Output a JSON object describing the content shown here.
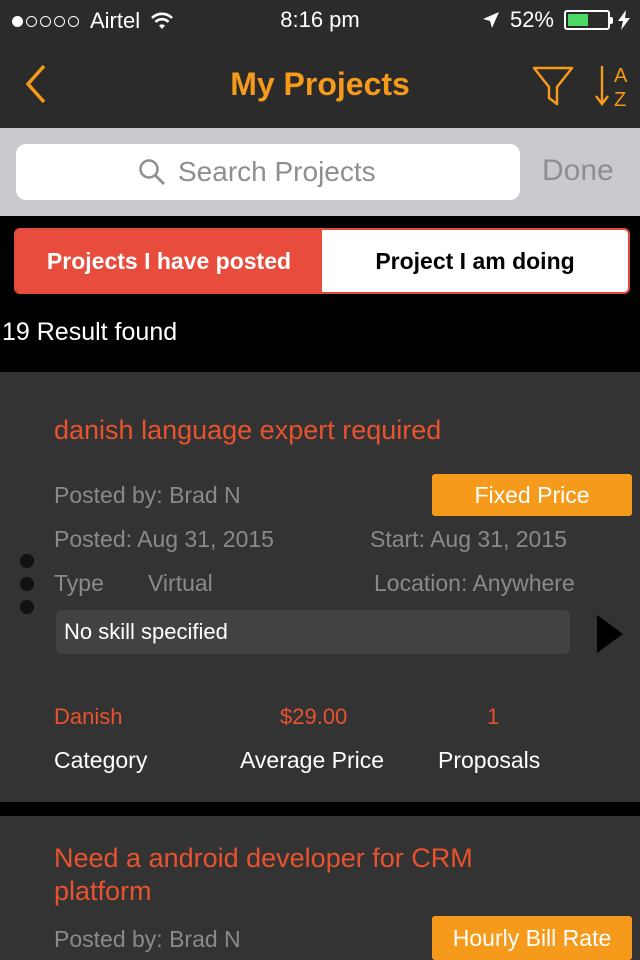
{
  "status": {
    "carrier": "Airtel",
    "time": "8:16 pm",
    "battery": "52%",
    "battery_level": 0.52
  },
  "nav": {
    "title": "My Projects"
  },
  "search": {
    "placeholder": "Search Projects",
    "done": "Done"
  },
  "segments": {
    "posted": "Projects I have posted",
    "doing": "Project I am doing"
  },
  "results": "19 Result found",
  "cards": [
    {
      "title": "danish language expert required",
      "posted_by": "Posted by: Brad N",
      "badge": "Fixed Price",
      "posted": "Posted: Aug 31, 2015",
      "start": "Start: Aug 31, 2015",
      "type_label": "Type",
      "type_value": "Virtual",
      "location": "Location: Anywhere",
      "skills": "No skill specified",
      "category_value": "Danish",
      "category_label": "Category",
      "price_value": "$29.00",
      "price_label": "Average Price",
      "proposals_value": "1",
      "proposals_label": "Proposals"
    },
    {
      "title_line1": "Need a android developer for CRM",
      "title_line2": "platform",
      "posted_by": "Posted by: Brad N",
      "badge": "Hourly Bill Rate"
    }
  ],
  "colors": {
    "accent": "#f59a1a",
    "red": "#e74c3c",
    "card": "#333333"
  }
}
